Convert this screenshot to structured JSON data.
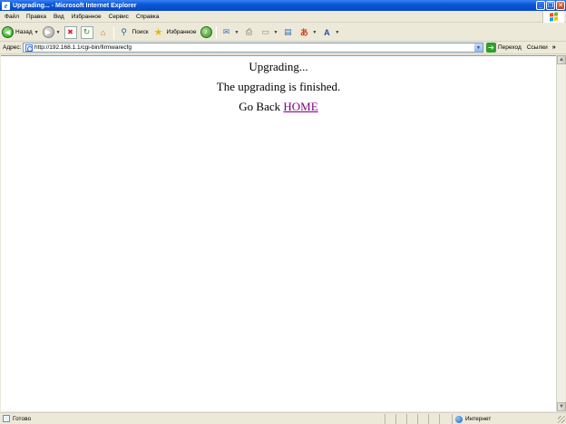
{
  "window": {
    "title": "Upgrading... - Microsoft Internet Explorer",
    "minimize": "_",
    "maximize": "❐",
    "close": "✕"
  },
  "menu": [
    "Файл",
    "Правка",
    "Вид",
    "Избранное",
    "Сервис",
    "Справка"
  ],
  "toolbar": {
    "back_label": "Назад",
    "search_label": "Поиск",
    "favorites_label": "Избранное"
  },
  "address": {
    "label": "Адрес:",
    "url": "http://192.168.1.1/cgi-bin/firmwarecfg",
    "go_label": "Переход",
    "links_label": "Ссылки"
  },
  "page": {
    "line1": "Upgrading...",
    "line2": "The upgrading is finished.",
    "line3_prefix": "Go Back ",
    "home_link": "HOME"
  },
  "status": {
    "text": "Готово",
    "zone": "Интернет"
  },
  "colors": {
    "titlebar": "#0A57DA",
    "chrome": "#ECE9D8",
    "visited_link": "#800080",
    "go_button": "#2F9E2A"
  }
}
